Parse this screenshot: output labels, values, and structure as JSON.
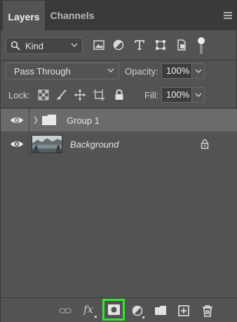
{
  "tabs": [
    {
      "label": "Layers",
      "active": true
    },
    {
      "label": "Channels",
      "active": false
    }
  ],
  "filter": {
    "kind_label": "Kind",
    "icons": [
      "pixel-filter-icon",
      "adjustment-filter-icon",
      "type-filter-icon",
      "shape-filter-icon",
      "smart-object-filter-icon"
    ]
  },
  "blend": {
    "mode": "Pass Through",
    "opacity_label": "Opacity:",
    "opacity_value": "100%"
  },
  "lock": {
    "label": "Lock:",
    "fill_label": "Fill:",
    "fill_value": "100%",
    "icons": [
      "lock-transparent-pixels-icon",
      "lock-image-pixels-icon",
      "lock-position-icon",
      "lock-artboard-icon",
      "lock-all-icon"
    ]
  },
  "layers": [
    {
      "name": "Group 1",
      "type": "group",
      "visible": true,
      "selected": true
    },
    {
      "name": "Background",
      "type": "pixel",
      "visible": true,
      "selected": false,
      "locked": true
    }
  ],
  "bottom_bar": {
    "fx_label": "fx",
    "icons": [
      "link-layers-icon",
      "fx-icon",
      "add-layer-mask-icon",
      "new-adjustment-layer-icon",
      "new-group-icon",
      "new-layer-icon",
      "delete-layer-icon"
    ],
    "highlight_color": "#2ee62e"
  },
  "colors": {
    "panel_bg": "#535353",
    "tabbar_bg": "#3a3a3a",
    "selected_row": "#6b6b6b"
  }
}
